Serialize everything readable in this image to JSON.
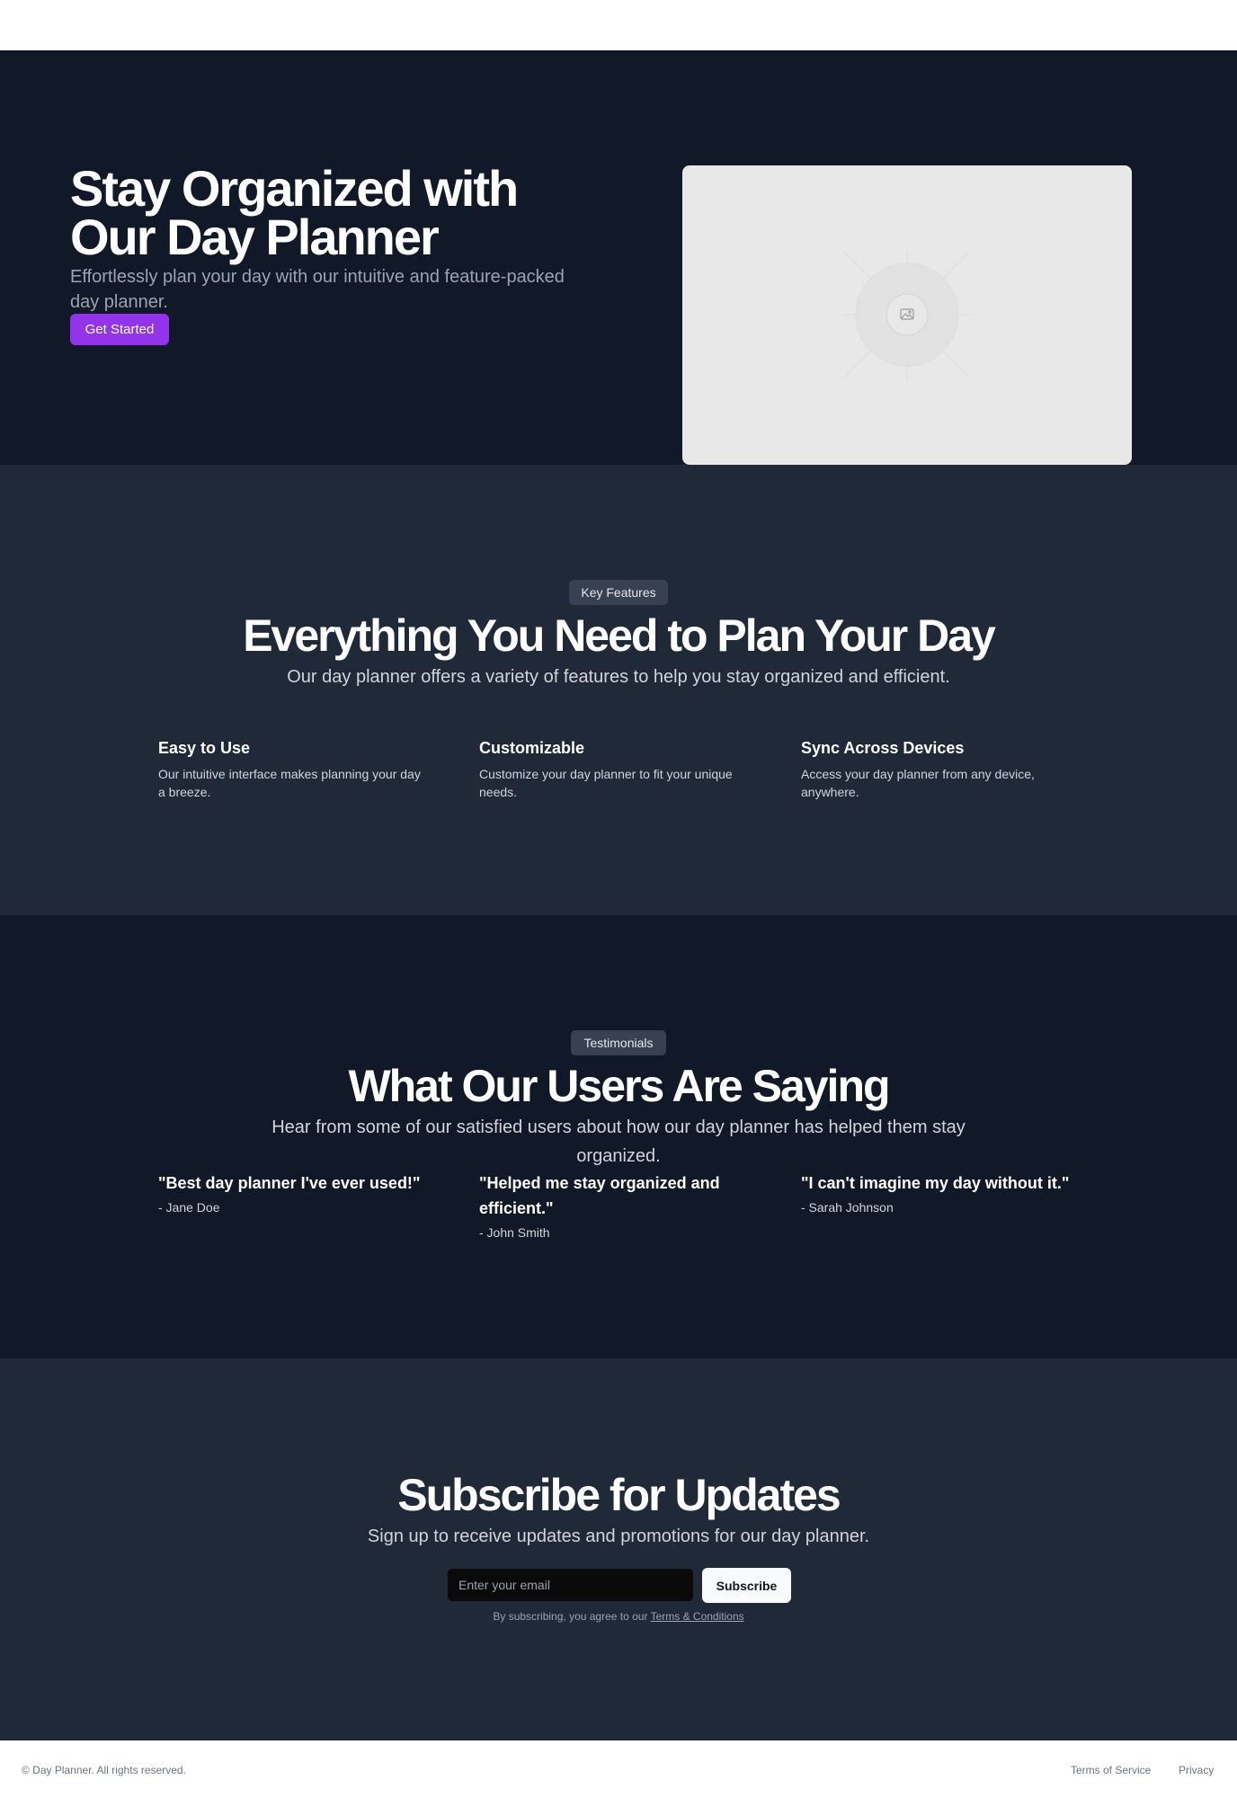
{
  "hero": {
    "title": "Stay Organized with Our Day Planner",
    "subtitle": "Effortlessly plan your day with our intuitive and feature-packed day planner.",
    "cta_label": "Get Started"
  },
  "features": {
    "badge": "Key Features",
    "title": "Everything You Need to Plan Your Day",
    "subtitle": "Our day planner offers a variety of features to help you stay organized and efficient.",
    "items": [
      {
        "title": "Easy to Use",
        "description": "Our intuitive interface makes planning your day a breeze."
      },
      {
        "title": "Customizable",
        "description": "Customize your day planner to fit your unique needs."
      },
      {
        "title": "Sync Across Devices",
        "description": "Access your day planner from any device, anywhere."
      }
    ]
  },
  "testimonials": {
    "badge": "Testimonials",
    "title": "What Our Users Are Saying",
    "subtitle": "Hear from some of our satisfied users about how our day planner has helped them stay organized.",
    "items": [
      {
        "quote": "\"Best day planner I've ever used!\"",
        "author": "- Jane Doe"
      },
      {
        "quote": "\"Helped me stay organized and efficient.\"",
        "author": "- John Smith"
      },
      {
        "quote": "\"I can't imagine my day without it.\"",
        "author": "- Sarah Johnson"
      }
    ]
  },
  "subscribe": {
    "title": "Subscribe for Updates",
    "subtitle": "Sign up to receive updates and promotions for our day planner.",
    "email_placeholder": "Enter your email",
    "button_label": "Subscribe",
    "terms_prefix": "By subscribing, you agree to our ",
    "terms_link": "Terms & Conditions"
  },
  "footer": {
    "copyright": "© Day Planner. All rights reserved.",
    "links": [
      "Terms of Service",
      "Privacy"
    ]
  },
  "icons": {
    "hero_image": "image-placeholder-icon"
  },
  "colors": {
    "accent": "#9333ea",
    "dark_bg": "#111827",
    "section_bg": "#1f2937",
    "badge_bg": "#374151"
  }
}
